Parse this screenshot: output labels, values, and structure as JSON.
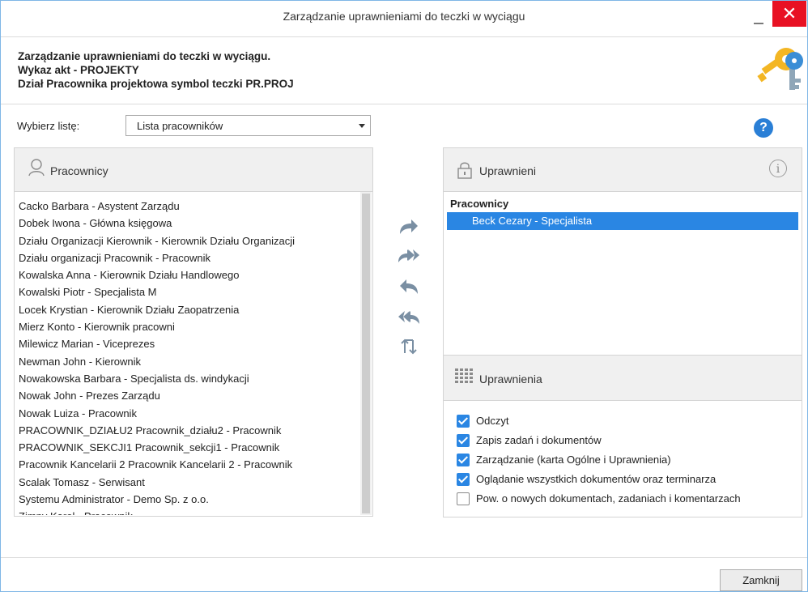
{
  "window": {
    "title": "Zarządzanie uprawnieniami do teczki w wyciągu",
    "close_glyph": "✕"
  },
  "header": {
    "line1": "Zarządzanie uprawnieniami do teczki w wyciągu.",
    "line2": "Wykaz akt - PROJEKTY",
    "line3": "Dział Pracownika projektowa symbol teczki PR.PROJ"
  },
  "selector": {
    "label": "Wybierz listę:",
    "value": "Lista pracowników"
  },
  "help": {
    "glyph": "?"
  },
  "left_panel": {
    "title": "Pracownicy",
    "items": [
      "Cacko Barbara - Asystent Zarządu",
      "Dobek Iwona - Główna księgowa",
      "Działu Organizacji Kierownik - Kierownik Działu Organizacji",
      "Działu organizacji Pracownik - Pracownik",
      "Kowalska Anna - Kierownik Działu Handlowego",
      "Kowalski Piotr - Specjalista M",
      "Locek Krystian - Kierownik Działu Zaopatrzenia",
      "Mierz Konto - Kierownik pracowni",
      "Milewicz Marian - Viceprezes",
      "Newman John - Kierownik",
      "Nowakowska Barbara - Specjalista ds. windykacji",
      "Nowak John - Prezes Zarządu",
      "Nowak Luiza - Pracownik",
      "PRACOWNIK_DZIAŁU2 Pracownik_działu2 - Pracownik",
      "PRACOWNIK_SEKCJI1 Pracownik_sekcji1 - Pracownik",
      "Pracownik Kancelarii 2 Pracownik Kancelarii 2 - Pracownik",
      "Scalak Tomasz - Serwisant",
      "Systemu Administrator - Demo Sp. z o.o.",
      "Zimny Karol - Pracownik"
    ]
  },
  "right_top": {
    "title": "Uprawnieni",
    "group": "Pracownicy",
    "selected": "Beck Cezary - Specjalista",
    "info_glyph": "i"
  },
  "right_bottom": {
    "title": "Uprawnienia",
    "options": [
      {
        "label": "Odczyt",
        "checked": true
      },
      {
        "label": "Zapis zadań i dokumentów",
        "checked": true
      },
      {
        "label": "Zarządzanie (karta Ogólne i Uprawnienia)",
        "checked": true
      },
      {
        "label": "Oglądanie wszystkich dokumentów oraz terminarza",
        "checked": true
      },
      {
        "label": "Pow. o nowych dokumentach, zadaniach i komentarzach",
        "checked": false
      }
    ]
  },
  "footer": {
    "close_label": "Zamknij"
  },
  "colors": {
    "accent": "#2a86e3",
    "close": "#e81123",
    "border": "#7fb6e6",
    "panel_header": "#f0f0f0"
  }
}
